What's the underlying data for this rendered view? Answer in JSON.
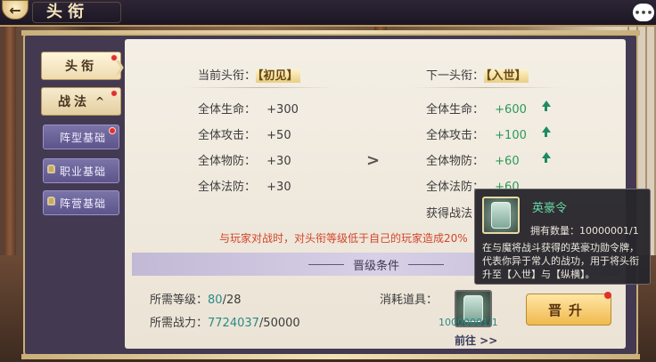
{
  "header": {
    "title": "头衔",
    "back_icon": "back-arrow-icon",
    "chat_icon_label": "•••"
  },
  "sidebar": {
    "tabs": [
      {
        "label": "头衔",
        "active": true,
        "badge": true
      },
      {
        "label": "战法",
        "suffix": "^",
        "badge": true
      }
    ],
    "subtabs": [
      {
        "label": "阵型基础",
        "badge": true,
        "locked": false
      },
      {
        "label": "职业基础",
        "badge": false,
        "locked": true
      },
      {
        "label": "阵营基础",
        "badge": false,
        "locked": true
      }
    ]
  },
  "current": {
    "label": "当前头衔：",
    "title": "【初见】",
    "stats": [
      {
        "label": "全体生命：",
        "value": "+300"
      },
      {
        "label": "全体攻击：",
        "value": "+50"
      },
      {
        "label": "全体物防：",
        "value": "+30"
      },
      {
        "label": "全体法防：",
        "value": "+30"
      }
    ]
  },
  "next": {
    "label": "下一头衔：",
    "title": "【入世】",
    "stats": [
      {
        "label": "全体生命：",
        "value": "+600"
      },
      {
        "label": "全体攻击：",
        "value": "+100"
      },
      {
        "label": "全体物防：",
        "value": "+60"
      },
      {
        "label": "全体法防：",
        "value": "+60"
      }
    ],
    "extra_label": "获得战法"
  },
  "warning": "与玩家对战时，对头衔等级低于自己的玩家造成20%",
  "conditions": {
    "title": "晋级条件",
    "level_label": "所需等级：",
    "level_current": "80",
    "level_required": "/28",
    "power_label": "所需战力：",
    "power_current": "7724037",
    "power_required": "/50000",
    "consume_label": "消耗道具：",
    "item_count": "10000001/1",
    "goto_label": "前往 >>"
  },
  "promote_button": "晋升",
  "tooltip": {
    "name": "英豪令",
    "owned": "拥有数量：10000001/1",
    "description": "在与魔将战斗获得的英豪功勋令牌，代表你异于常人的战功，用于将头衔升至【入世】与【纵横】。"
  },
  "colors": {
    "accent_green": "#2b9a59",
    "warning_red": "#d2452a",
    "gold": "#c9b07a"
  }
}
